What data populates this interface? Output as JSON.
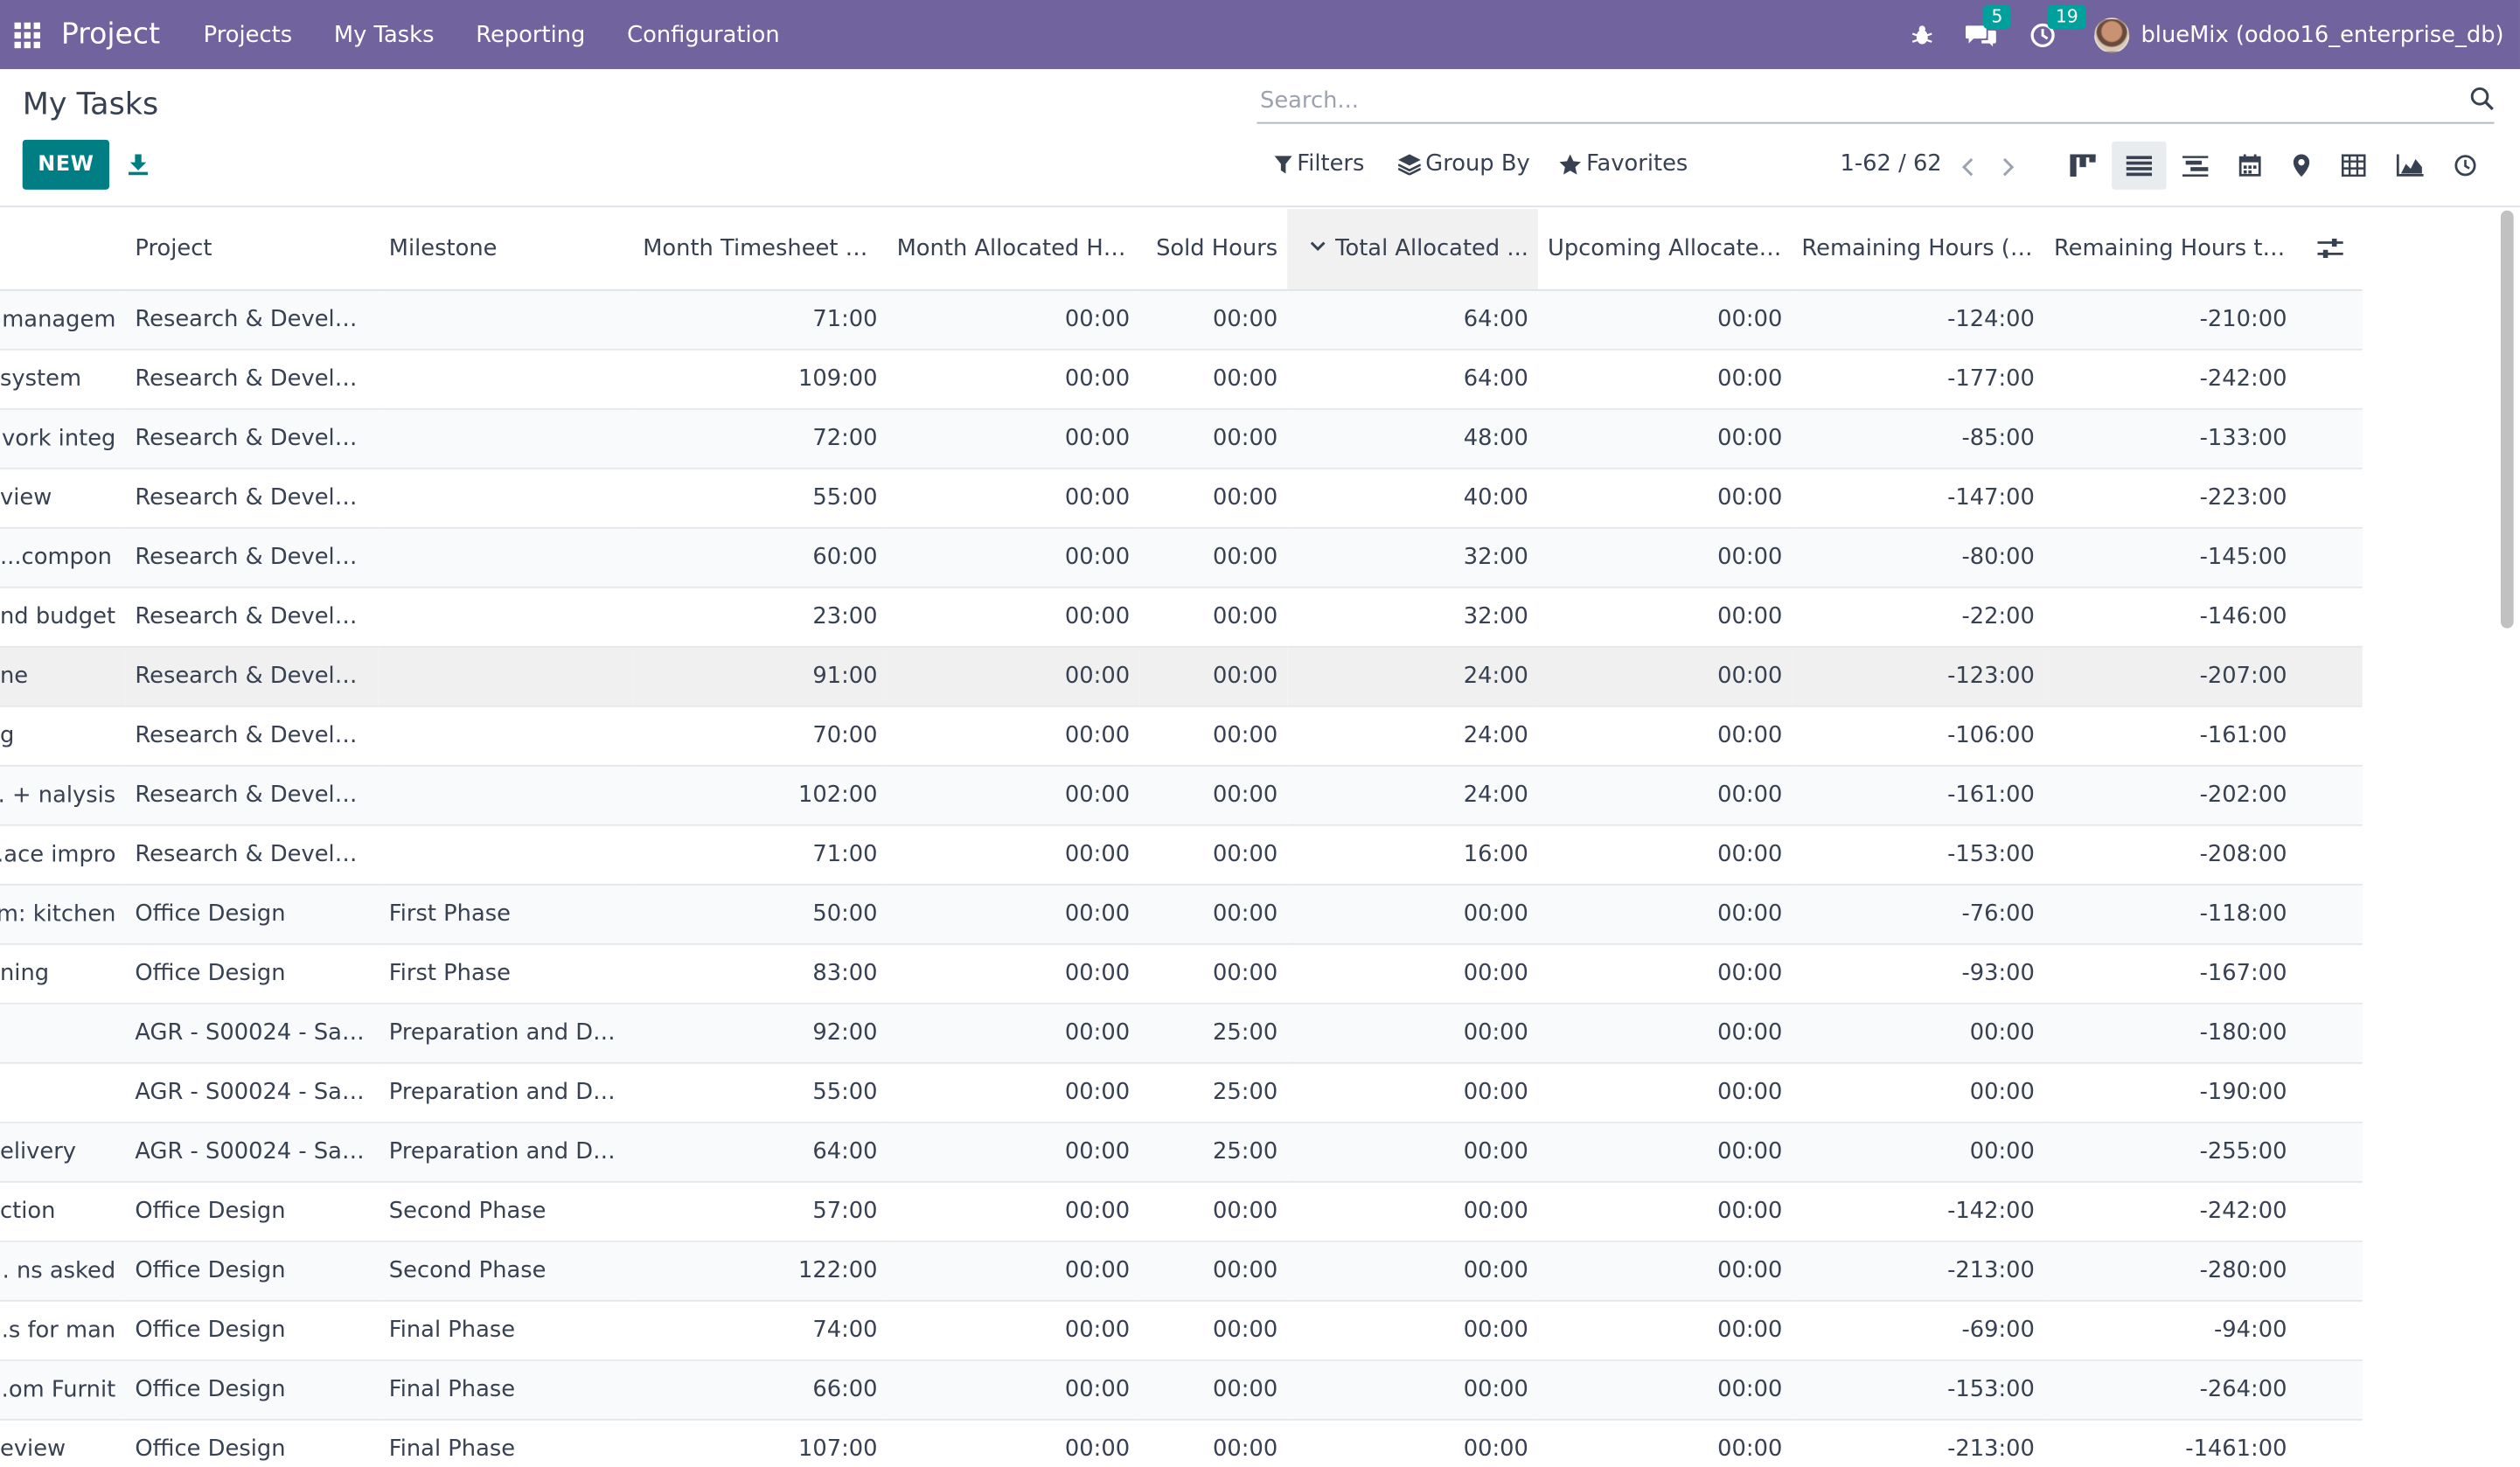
{
  "navbar": {
    "brand": "Project",
    "menu": [
      "Projects",
      "My Tasks",
      "Reporting",
      "Configuration"
    ],
    "messages_count": "5",
    "activities_count": "19",
    "user": "blueMix (odoo16_enterprise_db)",
    "color": "#71639e"
  },
  "control_panel": {
    "title": "My Tasks",
    "new_label": "NEW",
    "search_placeholder": "Search...",
    "filters_label": "Filters",
    "groupby_label": "Group By",
    "favorites_label": "Favorites",
    "pager": "1-62 / 62",
    "views": [
      "kanban-icon",
      "list-icon",
      "gantt-icon",
      "calendar-icon",
      "map-icon",
      "pivot-icon",
      "graph-icon",
      "activity-icon"
    ],
    "active_view": "list-icon",
    "accent": "#017e84"
  },
  "table": {
    "headers": {
      "project": "Project",
      "milestone": "Milestone",
      "month_timesheet": "Month Timesheet H...",
      "month_allocated": "Month Allocated Ho...",
      "sold": "Sold Hours",
      "total_allocated": "Total Allocated ...",
      "upcoming": "Upcoming Allocated...",
      "remaining_pl": "Remaining Hours (Pl...",
      "remaining_to": "Remaining Hours to ..."
    },
    "rows": [
      {
        "task": "managem...",
        "project": "Research & Develop...",
        "milestone": "",
        "mt": "71:00",
        "ma": "00:00",
        "sold": "00:00",
        "ta": "64:00",
        "up": "00:00",
        "rp": "-124:00",
        "rt": "-210:00"
      },
      {
        "task": "system",
        "project": "Research & Develop...",
        "milestone": "",
        "mt": "109:00",
        "ma": "00:00",
        "sold": "00:00",
        "ta": "64:00",
        "up": "00:00",
        "rp": "-177:00",
        "rt": "-242:00"
      },
      {
        "task": "vork integ...",
        "project": "Research & Develop...",
        "milestone": "",
        "mt": "72:00",
        "ma": "00:00",
        "sold": "00:00",
        "ta": "48:00",
        "up": "00:00",
        "rp": "-85:00",
        "rt": "-133:00"
      },
      {
        "task": "view",
        "project": "Research & Develop...",
        "milestone": "",
        "mt": "55:00",
        "ma": "00:00",
        "sold": "00:00",
        "ta": "40:00",
        "up": "00:00",
        "rp": "-147:00",
        "rt": "-223:00"
      },
      {
        "task": "compon...",
        "project": "Research & Develop...",
        "milestone": "",
        "mt": "60:00",
        "ma": "00:00",
        "sold": "00:00",
        "ta": "32:00",
        "up": "00:00",
        "rp": "-80:00",
        "rt": "-145:00"
      },
      {
        "task": "nd budget",
        "project": "Research & Develop...",
        "milestone": "",
        "mt": "23:00",
        "ma": "00:00",
        "sold": "00:00",
        "ta": "32:00",
        "up": "00:00",
        "rp": "-22:00",
        "rt": "-146:00"
      },
      {
        "task": "ne",
        "project": "Research & Develop...",
        "milestone": "",
        "mt": "91:00",
        "ma": "00:00",
        "sold": "00:00",
        "ta": "24:00",
        "up": "00:00",
        "rp": "-123:00",
        "rt": "-207:00"
      },
      {
        "task": "g",
        "project": "Research & Develop...",
        "milestone": "",
        "mt": "70:00",
        "ma": "00:00",
        "sold": "00:00",
        "ta": "24:00",
        "up": "00:00",
        "rp": "-106:00",
        "rt": "-161:00"
      },
      {
        "task": "nalysis + ...",
        "project": "Research & Develop...",
        "milestone": "",
        "mt": "102:00",
        "ma": "00:00",
        "sold": "00:00",
        "ta": "24:00",
        "up": "00:00",
        "rp": "-161:00",
        "rt": "-202:00"
      },
      {
        "task": "ace impro...",
        "project": "Research & Develop...",
        "milestone": "",
        "mt": "71:00",
        "ma": "00:00",
        "sold": "00:00",
        "ta": "16:00",
        "up": "00:00",
        "rp": "-153:00",
        "rt": "-208:00"
      },
      {
        "task": "m: kitchen",
        "project": "Office Design",
        "milestone": "First Phase",
        "mt": "50:00",
        "ma": "00:00",
        "sold": "00:00",
        "ta": "00:00",
        "up": "00:00",
        "rp": "-76:00",
        "rt": "-118:00"
      },
      {
        "task": "ning",
        "project": "Office Design",
        "milestone": "First Phase",
        "mt": "83:00",
        "ma": "00:00",
        "sold": "00:00",
        "ta": "00:00",
        "up": "00:00",
        "rp": "-93:00",
        "rt": "-167:00"
      },
      {
        "task": "",
        "project": "AGR - S00024 - Sale...",
        "milestone": "Preparation and Deli...",
        "mt": "92:00",
        "ma": "00:00",
        "sold": "25:00",
        "ta": "00:00",
        "up": "00:00",
        "rp": "00:00",
        "rt": "-180:00"
      },
      {
        "task": "",
        "project": "AGR - S00024 - Sale...",
        "milestone": "Preparation and Deli...",
        "mt": "55:00",
        "ma": "00:00",
        "sold": "25:00",
        "ta": "00:00",
        "up": "00:00",
        "rp": "00:00",
        "rt": "-190:00"
      },
      {
        "task": "elivery",
        "project": "AGR - S00024 - Sale...",
        "milestone": "Preparation and Deli...",
        "mt": "64:00",
        "ma": "00:00",
        "sold": "25:00",
        "ta": "00:00",
        "up": "00:00",
        "rp": "00:00",
        "rt": "-255:00"
      },
      {
        "task": "ction",
        "project": "Office Design",
        "milestone": "Second Phase",
        "mt": "57:00",
        "ma": "00:00",
        "sold": "00:00",
        "ta": "00:00",
        "up": "00:00",
        "rp": "-142:00",
        "rt": "-242:00"
      },
      {
        "task": "ns asked ...",
        "project": "Office Design",
        "milestone": "Second Phase",
        "mt": "122:00",
        "ma": "00:00",
        "sold": "00:00",
        "ta": "00:00",
        "up": "00:00",
        "rp": "-213:00",
        "rt": "-280:00"
      },
      {
        "task": "s for man...",
        "project": "Office Design",
        "milestone": "Final Phase",
        "mt": "74:00",
        "ma": "00:00",
        "sold": "00:00",
        "ta": "00:00",
        "up": "00:00",
        "rp": "-69:00",
        "rt": "-94:00"
      },
      {
        "task": "om Furnit...",
        "project": "Office Design",
        "milestone": "Final Phase",
        "mt": "66:00",
        "ma": "00:00",
        "sold": "00:00",
        "ta": "00:00",
        "up": "00:00",
        "rp": "-153:00",
        "rt": "-264:00"
      },
      {
        "task": "eview",
        "project": "Office Design",
        "milestone": "Final Phase",
        "mt": "107:00",
        "ma": "00:00",
        "sold": "00:00",
        "ta": "00:00",
        "up": "00:00",
        "rp": "-213:00",
        "rt": "-1461:00"
      }
    ]
  }
}
